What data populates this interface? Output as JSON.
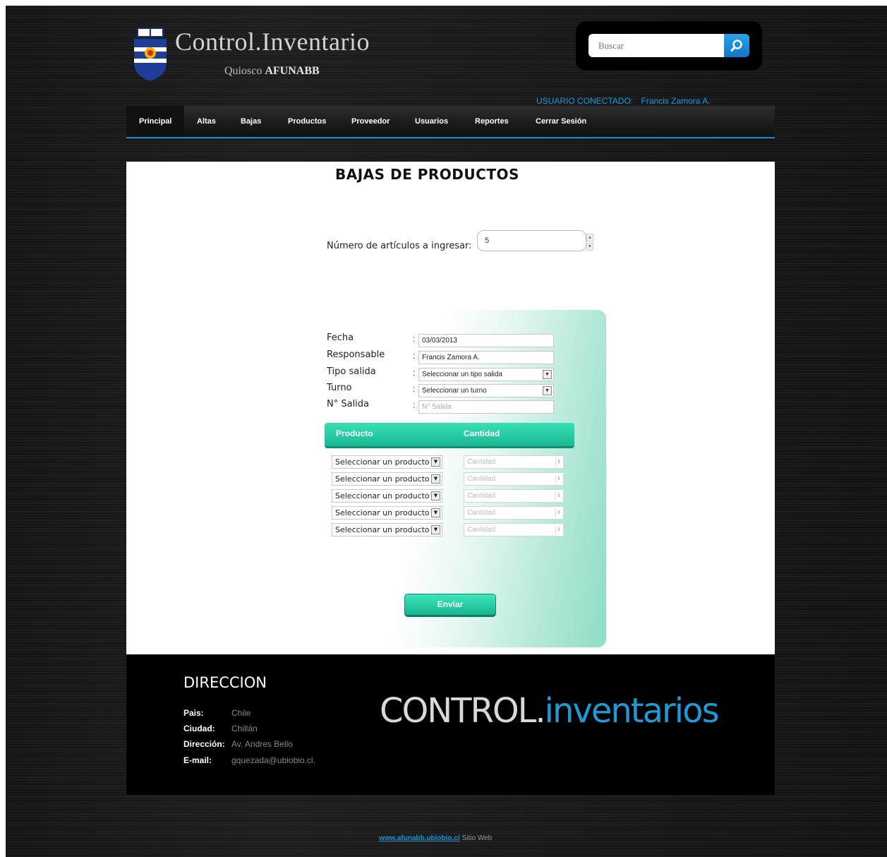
{
  "header": {
    "title": "Control.Inventario",
    "subtitle_prefix": "Quiosco",
    "subtitle_name": "AFUNABB",
    "search_placeholder": "Buscar",
    "user_label": "USUARIO CONECTADO:",
    "user_name": "Francis Zamora A."
  },
  "nav": {
    "items": [
      "Principal",
      "Altas",
      "Bajas",
      "Productos",
      "Proveedor",
      "Usuarios",
      "Reportes",
      "Cerrar Sesión"
    ],
    "active": "Principal"
  },
  "main": {
    "title": "BAJAS DE PRODUCTOS",
    "count_label": "Número de artículos a ingresar:",
    "count_value": "5",
    "fields": [
      {
        "label": "Fecha",
        "value": "03/03/2013"
      },
      {
        "label": "Responsable",
        "value": "Francis Zamora A."
      },
      {
        "label": "Tipo salida",
        "value": "Seleccionar un tipo salida"
      },
      {
        "label": "Turno",
        "value": "Seleccionar un turno"
      },
      {
        "label": "N° Salida",
        "placeholder": "N° Salida"
      }
    ],
    "table": {
      "col_product": "Producto",
      "col_quantity": "Cantidad",
      "row_select": "Seleccionar un producto",
      "row_qty_placeholder": "Cantidad",
      "rows": 5
    },
    "send_label": "Enviar"
  },
  "footer": {
    "heading": "DIRECCION",
    "rows": [
      {
        "k": "Pais:",
        "v": "Chile"
      },
      {
        "k": "Ciudad:",
        "v": "Chillán"
      },
      {
        "k": "Dirección:",
        "v": "Av. Andres Bello"
      },
      {
        "k": "E-mail:",
        "v": "gquezada@ubiobio.cl."
      }
    ],
    "brand_a": "CONTROL.",
    "brand_b": "inventarios"
  },
  "bottom": {
    "link": "www.afunabb.ubiobio.cl",
    "text": "Sitio Web"
  },
  "colors": {
    "accent_teal": "#1ab894",
    "accent_blue": "#1e9ad6"
  }
}
